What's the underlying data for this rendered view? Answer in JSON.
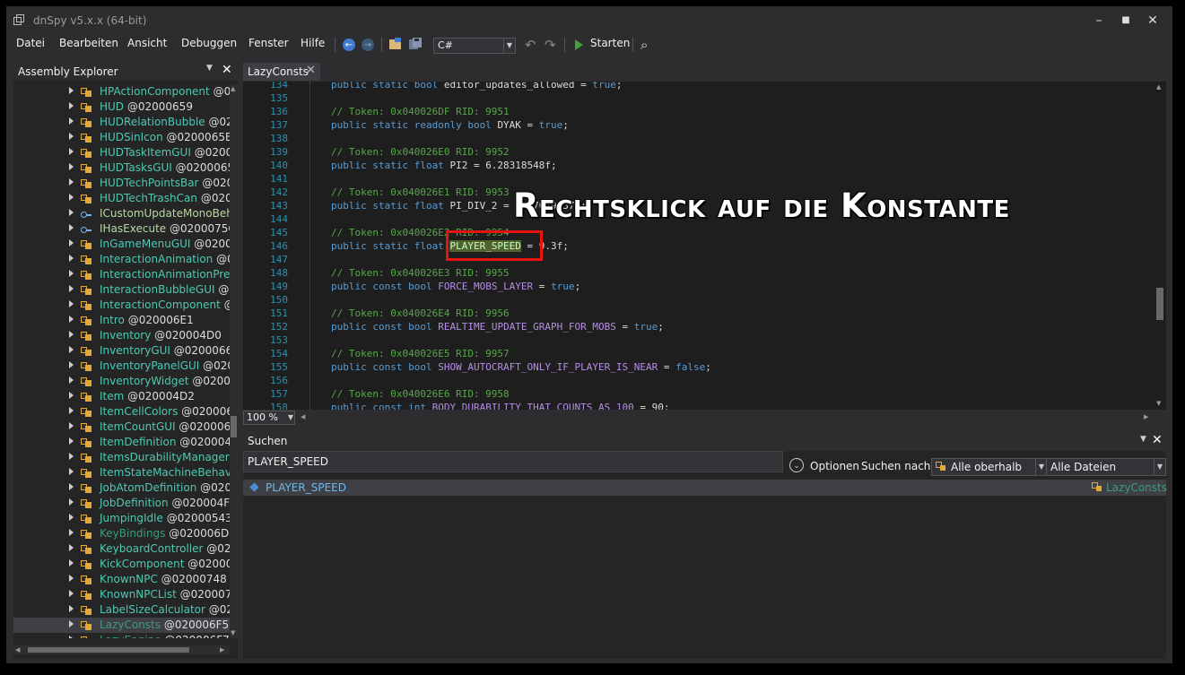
{
  "window": {
    "title": "dnSpy v5.x.x (64-bit)",
    "minimize": "–",
    "maximize": "■",
    "close": "✕"
  },
  "menu": [
    "Datei",
    "Bearbeiten",
    "Ansicht",
    "Debuggen",
    "Fenster",
    "Hilfe"
  ],
  "toolbar": {
    "icons": [
      "back-icon",
      "forward-icon",
      "open-file-icon",
      "save-icon",
      "undo-icon",
      "redo-icon",
      "run-icon",
      "search-icon"
    ],
    "back_glyph": "←",
    "forward_glyph": "→",
    "undo_glyph": "↶",
    "redo_glyph": "↷",
    "search_glyph": "⌕",
    "language": "C#",
    "run_label": "Starten"
  },
  "assembly_explorer": {
    "title": "Assembly Explorer",
    "pin": "▼",
    "close": "✕",
    "items": [
      {
        "name": "HPActionComponent",
        "token": "@0",
        "kind": "class"
      },
      {
        "name": "HUD",
        "token": "@02000659",
        "kind": "class"
      },
      {
        "name": "HUDRelationBubble",
        "token": "@020",
        "kind": "class"
      },
      {
        "name": "HUDSinIcon",
        "token": "@0200065B",
        "kind": "class"
      },
      {
        "name": "HUDTaskItemGUI",
        "token": "@02000",
        "kind": "class"
      },
      {
        "name": "HUDTasksGUI",
        "token": "@0200065D",
        "kind": "class"
      },
      {
        "name": "HUDTechPointsBar",
        "token": "@0200",
        "kind": "class"
      },
      {
        "name": "HUDTechTrashCan",
        "token": "@0200",
        "kind": "class"
      },
      {
        "name": "ICustomUpdateMonoBeh",
        "token": "",
        "kind": "interface"
      },
      {
        "name": "IHasExecute",
        "token": "@0200075C",
        "kind": "interface"
      },
      {
        "name": "InGameMenuGUI",
        "token": "@02000",
        "kind": "class"
      },
      {
        "name": "InteractionAnimation",
        "token": "@0",
        "kind": "class"
      },
      {
        "name": "InteractionAnimationPres",
        "token": "",
        "kind": "class"
      },
      {
        "name": "InteractionBubbleGUI",
        "token": "@0",
        "kind": "class"
      },
      {
        "name": "InteractionComponent",
        "token": "@",
        "kind": "class"
      },
      {
        "name": "Intro",
        "token": "@020006E1",
        "kind": "class"
      },
      {
        "name": "Inventory",
        "token": "@020004D0",
        "kind": "class"
      },
      {
        "name": "InventoryGUI",
        "token": "@0200066B",
        "kind": "class"
      },
      {
        "name": "InventoryPanelGUI",
        "token": "@0200",
        "kind": "class"
      },
      {
        "name": "InventoryWidget",
        "token": "@020006",
        "kind": "class"
      },
      {
        "name": "Item",
        "token": "@020004D2",
        "kind": "class"
      },
      {
        "name": "ItemCellColors",
        "token": "@0200067",
        "kind": "class"
      },
      {
        "name": "ItemCountGUI",
        "token": "@0200067F",
        "kind": "class"
      },
      {
        "name": "ItemDefinition",
        "token": "@020004E8",
        "kind": "class"
      },
      {
        "name": "ItemsDurabilityManager",
        "token": "@",
        "kind": "class"
      },
      {
        "name": "ItemStateMachineBehavic",
        "token": "",
        "kind": "class"
      },
      {
        "name": "JobAtomDefinition",
        "token": "@0200",
        "kind": "class"
      },
      {
        "name": "JobDefinition",
        "token": "@020004F2",
        "kind": "class"
      },
      {
        "name": "JumpingIdle",
        "token": "@02000543",
        "kind": "class"
      },
      {
        "name": "KeyBindings",
        "token": "@020006D8",
        "kind": "class-dim"
      },
      {
        "name": "KeyboardController",
        "token": "@020",
        "kind": "class"
      },
      {
        "name": "KickComponent",
        "token": "@020005",
        "kind": "class"
      },
      {
        "name": "KnownNPC",
        "token": "@02000748",
        "kind": "class"
      },
      {
        "name": "KnownNPCList",
        "token": "@0200074",
        "kind": "class"
      },
      {
        "name": "LabelSizeCalculator",
        "token": "@020",
        "kind": "class"
      },
      {
        "name": "LazyConsts",
        "token": "@020006F5",
        "kind": "class-dim",
        "selected": true
      },
      {
        "name": "LazyEngine",
        "token": "@020006F7",
        "kind": "class-dim"
      }
    ]
  },
  "editor": {
    "tab": "LazyConsts",
    "tab_close": "✕",
    "zoom": "100 %",
    "lines": [
      {
        "n": "134",
        "parts": [
          [
            "kw",
            "public static bool "
          ],
          [
            "tx",
            "editor_updates_allowed = "
          ],
          [
            "kw",
            "true"
          ],
          [
            "tx",
            ";"
          ]
        ]
      },
      {
        "n": "135",
        "parts": []
      },
      {
        "n": "136",
        "parts": [
          [
            "cm",
            "// Token: 0x040026DF RID: 9951"
          ]
        ]
      },
      {
        "n": "137",
        "parts": [
          [
            "kw",
            "public static readonly bool "
          ],
          [
            "tx",
            "DYAK = "
          ],
          [
            "kw",
            "true"
          ],
          [
            "tx",
            ";"
          ]
        ]
      },
      {
        "n": "138",
        "parts": []
      },
      {
        "n": "139",
        "parts": [
          [
            "cm",
            "// Token: 0x040026E0 RID: 9952"
          ]
        ]
      },
      {
        "n": "140",
        "parts": [
          [
            "kw",
            "public static float "
          ],
          [
            "tx",
            "PI2 = 6.28318548f;"
          ]
        ]
      },
      {
        "n": "141",
        "parts": []
      },
      {
        "n": "142",
        "parts": [
          [
            "cm",
            "// Token: 0x040026E1 RID: 9953"
          ]
        ]
      },
      {
        "n": "143",
        "parts": [
          [
            "kw",
            "public static float "
          ],
          [
            "tx",
            "PI_DIV_2 = 1.57079637f;"
          ]
        ]
      },
      {
        "n": "144",
        "parts": []
      },
      {
        "n": "145",
        "parts": [
          [
            "cm",
            "// Token: 0x040026E2 RID: 9954"
          ]
        ]
      },
      {
        "n": "146",
        "parts": [
          [
            "kw",
            "public static float "
          ],
          [
            "hl",
            "PLAYER_SPEED"
          ],
          [
            "tx",
            " = 9.3f;"
          ]
        ]
      },
      {
        "n": "147",
        "parts": []
      },
      {
        "n": "148",
        "parts": [
          [
            "cm",
            "// Token: 0x040026E3 RID: 9955"
          ]
        ]
      },
      {
        "n": "149",
        "parts": [
          [
            "kw",
            "public const bool "
          ],
          [
            "ct2",
            "FORCE_MOBS_LAYER"
          ],
          [
            "tx",
            " = "
          ],
          [
            "kw",
            "true"
          ],
          [
            "tx",
            ";"
          ]
        ]
      },
      {
        "n": "150",
        "parts": []
      },
      {
        "n": "151",
        "parts": [
          [
            "cm",
            "// Token: 0x040026E4 RID: 9956"
          ]
        ]
      },
      {
        "n": "152",
        "parts": [
          [
            "kw",
            "public const bool "
          ],
          [
            "ct2",
            "REALTIME_UPDATE_GRAPH_FOR_MOBS"
          ],
          [
            "tx",
            " = "
          ],
          [
            "kw",
            "true"
          ],
          [
            "tx",
            ";"
          ]
        ]
      },
      {
        "n": "153",
        "parts": []
      },
      {
        "n": "154",
        "parts": [
          [
            "cm",
            "// Token: 0x040026E5 RID: 9957"
          ]
        ]
      },
      {
        "n": "155",
        "parts": [
          [
            "kw",
            "public const bool "
          ],
          [
            "ct2",
            "SHOW_AUTOCRAFT_ONLY_IF_PLAYER_IS_NEAR"
          ],
          [
            "tx",
            " = "
          ],
          [
            "kw",
            "false"
          ],
          [
            "tx",
            ";"
          ]
        ]
      },
      {
        "n": "156",
        "parts": []
      },
      {
        "n": "157",
        "parts": [
          [
            "cm",
            "// Token: 0x040026E6 RID: 9958"
          ]
        ]
      },
      {
        "n": "158",
        "parts": [
          [
            "kw",
            "public const int "
          ],
          [
            "ct2",
            "BODY_DURABILITY_THAT_COUNTS_AS_100"
          ],
          [
            "tx",
            " = 90;"
          ]
        ]
      }
    ]
  },
  "search_panel": {
    "title": "Suchen",
    "pin": "▼",
    "close": "✕",
    "query": "PLAYER_SPEED",
    "options_label": "Optionen",
    "options_glyph": "⌄",
    "search_for_label": "Suchen nach:",
    "search_for_value": "Alle oberhalb",
    "scope_value": "Alle Dateien",
    "dropdown_arrow": "▼",
    "results": [
      {
        "name": "PLAYER_SPEED",
        "type": "LazyConsts"
      }
    ]
  },
  "annotation": {
    "text": "Rechtsklick auf die Konstante",
    "box_color": "#e5140f"
  }
}
